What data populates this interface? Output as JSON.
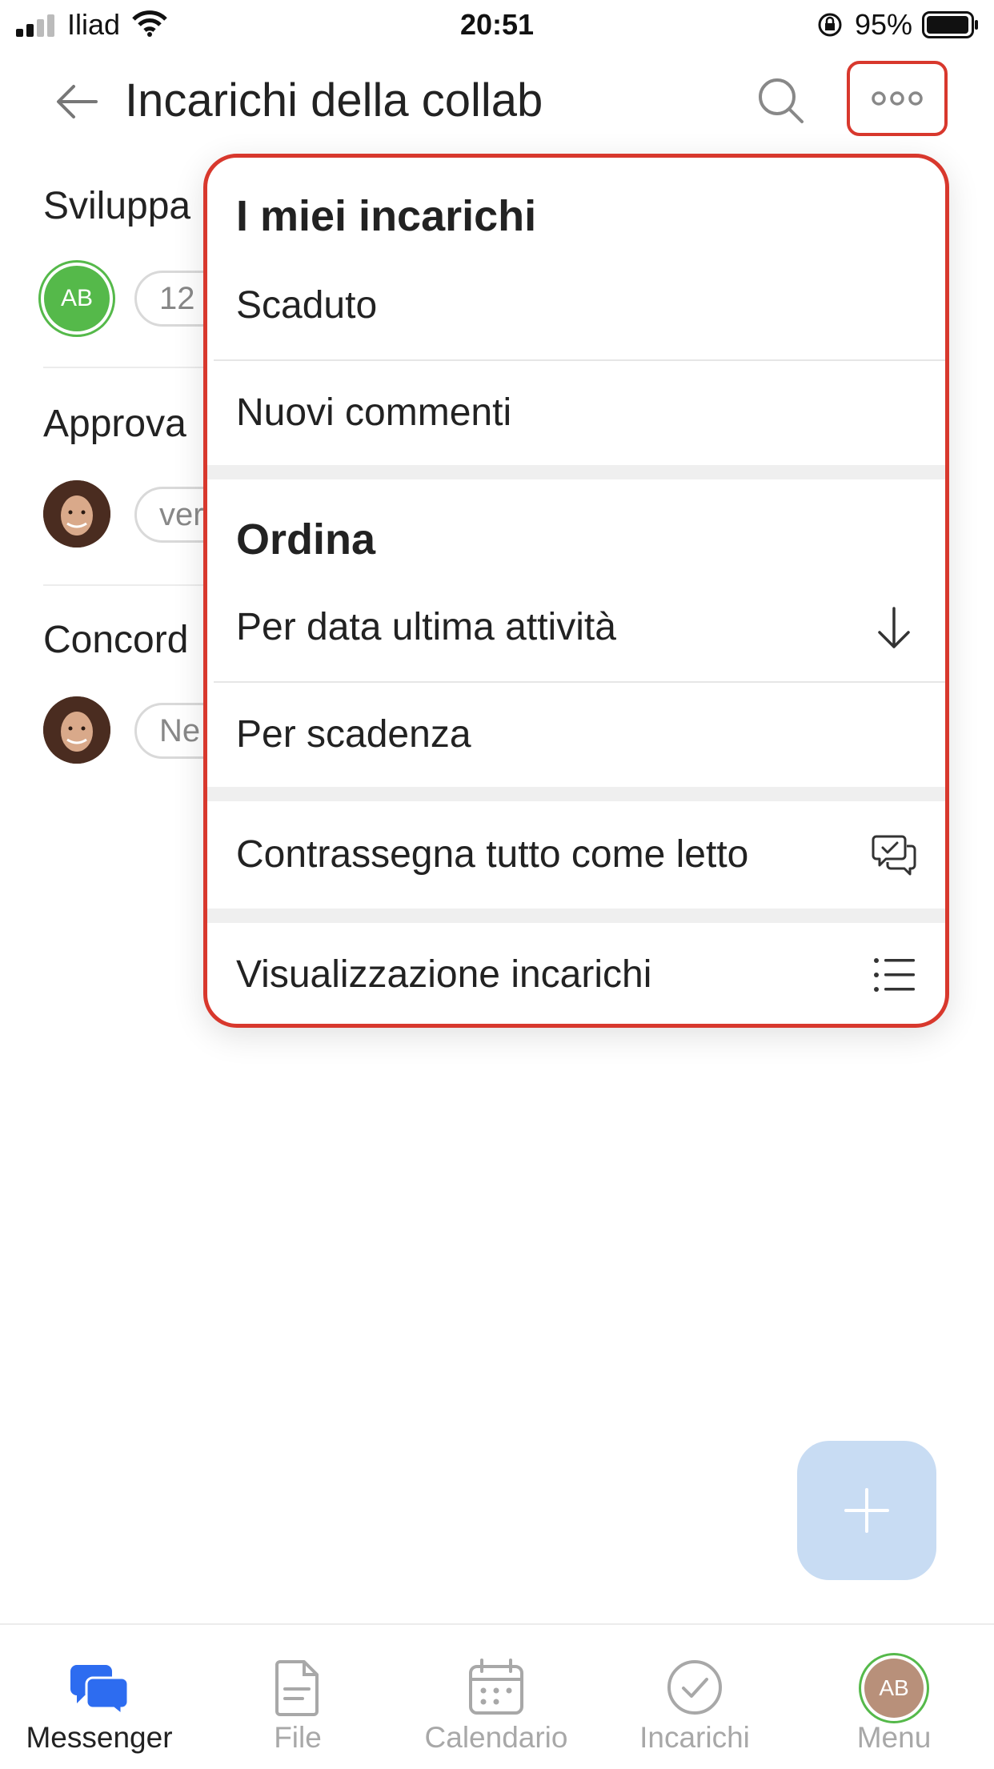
{
  "status_bar": {
    "carrier": "Iliad",
    "time": "20:51",
    "battery": "95%"
  },
  "header": {
    "title": "Incarichi della collab"
  },
  "background_list": [
    {
      "heading": "Sviluppa",
      "avatar_initials": "AB",
      "pill": "12"
    },
    {
      "heading": "Approva",
      "pill": "ver"
    },
    {
      "heading": "Concord",
      "pill": "Ne"
    }
  ],
  "menu": {
    "section1_title": "I miei incarichi",
    "overdue": "Scaduto",
    "new_comments": "Nuovi commenti",
    "section2_title": "Ordina",
    "sort_by_activity": "Per data ultima attività",
    "sort_by_deadline": "Per scadenza",
    "mark_all_read": "Contrassegna tutto come letto",
    "task_view": "Visualizzazione incarichi"
  },
  "tabbar": {
    "messenger": "Messenger",
    "file": "File",
    "calendar": "Calendario",
    "tasks": "Incarichi",
    "menu": "Menu",
    "menu_avatar": "AB"
  },
  "colors": {
    "highlight": "#d8382d",
    "accent": "#2d6cf0",
    "fab": "#c8dcf3",
    "avatar_green": "#55b94a"
  }
}
